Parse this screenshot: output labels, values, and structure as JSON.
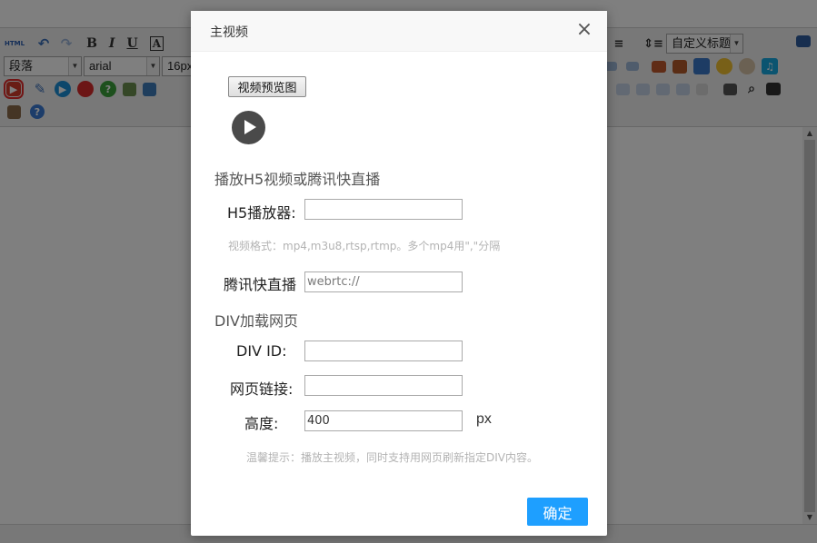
{
  "editor": {
    "format_select": "段落",
    "font_select": "arial",
    "size_select": "16px",
    "heading_select": "自定义标题",
    "toolbar_text": {
      "bold": "B",
      "italic": "I",
      "underline": "U",
      "fontcolor": "A"
    },
    "html_label": "HTML"
  },
  "dialog": {
    "title": "主视频",
    "close": "×",
    "preview_button": "视频预览图",
    "section_h5": "播放H5视频或腾讯快直播",
    "h5_label": "H5播放器:",
    "h5_value": "",
    "format_hint": "视频格式：mp4,m3u8,rtsp,rtmp。多个mp4用\",\"分隔",
    "tencent_label": "腾讯快直播",
    "tencent_placeholder": "webrtc://",
    "section_div": "DIV加载网页",
    "divid_label": "DIV ID:",
    "divid_value": "",
    "url_label": "网页链接:",
    "url_value": "",
    "height_label": "高度:",
    "height_value": "400",
    "height_unit": "px",
    "tip": "温馨提示：播放主视频，同时支持用网页刷新指定DIV内容。",
    "confirm": "确定"
  }
}
